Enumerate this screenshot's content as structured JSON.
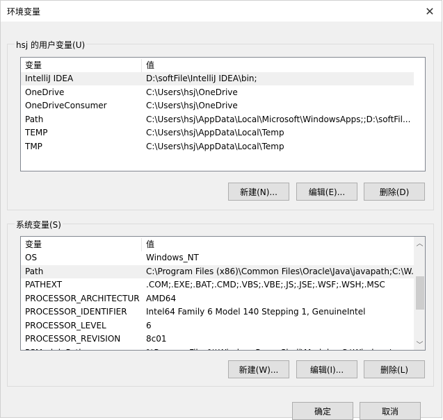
{
  "window": {
    "title": "环境变量"
  },
  "user_group": {
    "label": "hsj 的用户变量(U)",
    "columns": [
      "变量",
      "值"
    ],
    "rows": [
      [
        "IntelliJ IDEA",
        "D:\\softFile\\IntelliJ IDEA\\bin;"
      ],
      [
        "OneDrive",
        "C:\\Users\\hsj\\OneDrive"
      ],
      [
        "OneDriveConsumer",
        "C:\\Users\\hsj\\OneDrive"
      ],
      [
        "Path",
        "C:\\Users\\hsj\\AppData\\Local\\Microsoft\\WindowsApps;;D:\\softFil..."
      ],
      [
        "TEMP",
        "C:\\Users\\hsj\\AppData\\Local\\Temp"
      ],
      [
        "TMP",
        "C:\\Users\\hsj\\AppData\\Local\\Temp"
      ]
    ],
    "buttons": {
      "new": "新建(N)...",
      "edit": "编辑(E)...",
      "delete": "删除(D)"
    }
  },
  "system_group": {
    "label": "系统变量(S)",
    "columns": [
      "变量",
      "值"
    ],
    "rows": [
      [
        "OS",
        "Windows_NT"
      ],
      [
        "Path",
        "C:\\Program Files (x86)\\Common Files\\Oracle\\Java\\javapath;C:\\W..."
      ],
      [
        "PATHEXT",
        ".COM;.EXE;.BAT;.CMD;.VBS;.VBE;.JS;.JSE;.WSF;.WSH;.MSC"
      ],
      [
        "PROCESSOR_ARCHITECTURE",
        "AMD64"
      ],
      [
        "PROCESSOR_IDENTIFIER",
        "Intel64 Family 6 Model 140 Stepping 1, GenuineIntel"
      ],
      [
        "PROCESSOR_LEVEL",
        "6"
      ],
      [
        "PROCESSOR_REVISION",
        "8c01"
      ],
      [
        "PSModulePath",
        "%ProgramFiles%\\WindowsPowerShell\\Modules;C:\\Windows\\..."
      ]
    ],
    "buttons": {
      "new": "新建(W)...",
      "edit": "编辑(I)...",
      "delete": "删除(L)"
    }
  },
  "footer": {
    "ok": "确定",
    "cancel": "取消"
  },
  "icons": {
    "close": "close-icon",
    "scroll_up": "chevron-up-icon",
    "scroll_down": "chevron-down-icon"
  },
  "colors": {
    "selected_row": "#f0f0f0",
    "window_bg": "#f0f0f0"
  }
}
